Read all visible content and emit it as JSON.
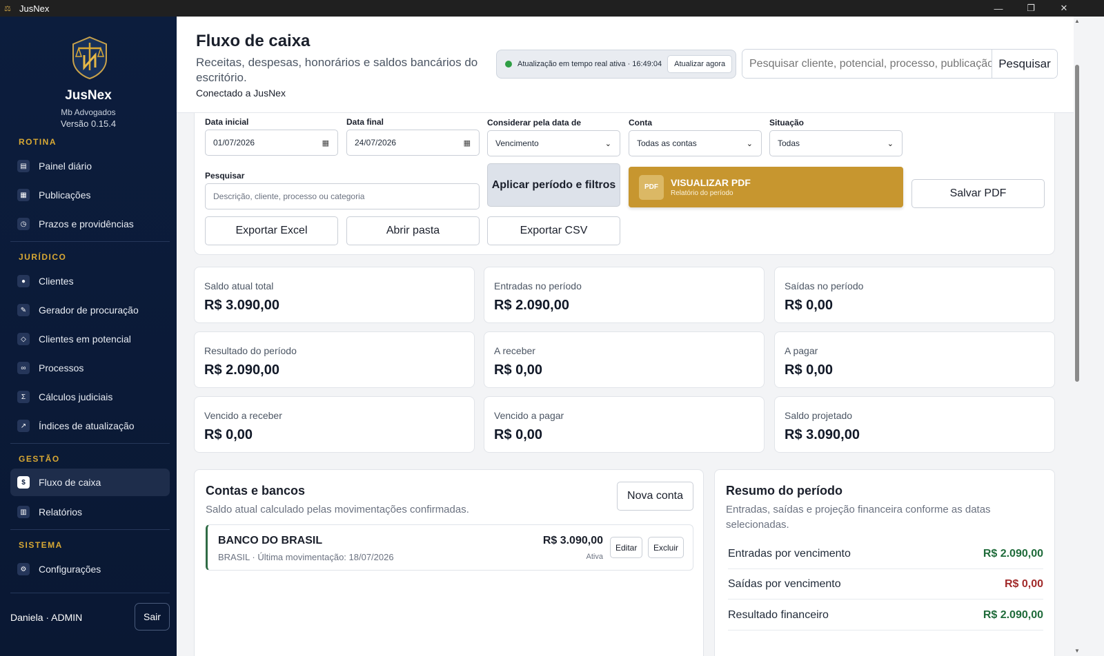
{
  "window": {
    "title": "JusNex",
    "minimize": "—",
    "maximize": "❐",
    "close": "✕"
  },
  "sidebar": {
    "brand": "JusNex",
    "org": "Mb Advogados",
    "version": "Versão 0.15.4",
    "sections": {
      "rotina": "ROTINA",
      "juridico": "JURÍDICO",
      "gestao": "GESTÃO",
      "sistema": "SISTEMA"
    },
    "items": {
      "painel": "Painel diário",
      "publicacoes": "Publicações",
      "prazos": "Prazos e providências",
      "clientes": "Clientes",
      "procuracao": "Gerador de procuração",
      "potencial": "Clientes em potencial",
      "processos": "Processos",
      "calculos": "Cálculos judiciais",
      "indices": "Índices de atualização",
      "fluxo": "Fluxo de caixa",
      "relatorios": "Relatórios",
      "config": "Configurações"
    },
    "user": "Daniela · ADMIN",
    "logout": "Sair"
  },
  "header": {
    "title": "Fluxo de caixa",
    "subtitle": "Receitas, despesas, honorários e saldos bancários do escritório.",
    "connected": "Conectado a JusNex",
    "realtime": "Atualização em tempo real ativa · 16:49:04",
    "refresh": "Atualizar agora",
    "search_placeholder": "Pesquisar cliente, potencial, processo, publicação",
    "search_button": "Pesquisar"
  },
  "filters": {
    "start_label": "Data inicial",
    "start_value": "01/07/2026",
    "end_label": "Data final",
    "end_value": "24/07/2026",
    "consider_label": "Considerar pela data de",
    "consider_value": "Vencimento",
    "account_label": "Conta",
    "account_value": "Todas as contas",
    "status_label": "Situação",
    "status_value": "Todas",
    "search_label": "Pesquisar",
    "search_placeholder": "Descrição, cliente, processo ou categoria",
    "apply": "Aplicar período e filtros",
    "pdf_badge": "PDF",
    "pdf_title": "VISUALIZAR PDF",
    "pdf_sub": "Relatório do período",
    "save_pdf": "Salvar PDF",
    "export_excel": "Exportar Excel",
    "open_folder": "Abrir pasta",
    "export_csv": "Exportar CSV"
  },
  "cards": [
    {
      "label": "Saldo atual total",
      "value": "R$ 3.090,00"
    },
    {
      "label": "Entradas no período",
      "value": "R$ 2.090,00"
    },
    {
      "label": "Saídas no período",
      "value": "R$ 0,00"
    },
    {
      "label": "Resultado do período",
      "value": "R$ 2.090,00"
    },
    {
      "label": "A receber",
      "value": "R$ 0,00"
    },
    {
      "label": "A pagar",
      "value": "R$ 0,00"
    },
    {
      "label": "Vencido a receber",
      "value": "R$ 0,00"
    },
    {
      "label": "Vencido a pagar",
      "value": "R$ 0,00"
    },
    {
      "label": "Saldo projetado",
      "value": "R$ 3.090,00"
    }
  ],
  "accounts": {
    "title": "Contas e bancos",
    "subtitle": "Saldo atual calculado pelas movimentações confirmadas.",
    "new_button": "Nova conta",
    "bank": {
      "name": "BANCO DO BRASIL",
      "info": "BRASIL · Última movimentação: 18/07/2026",
      "value": "R$ 3.090,00",
      "status": "Ativa",
      "edit": "Editar",
      "delete": "Excluir"
    }
  },
  "summary": {
    "title": "Resumo do período",
    "subtitle": "Entradas, saídas e projeção financeira conforme as datas selecionadas.",
    "rows": [
      {
        "label": "Entradas por vencimento",
        "value": "R$ 2.090,00",
        "color": "#1f6b3a"
      },
      {
        "label": "Saídas por vencimento",
        "value": "R$ 0,00",
        "color": "#a12a2a"
      },
      {
        "label": "Resultado financeiro",
        "value": "R$ 2.090,00",
        "color": "#1f6b3a"
      }
    ]
  },
  "colors": {
    "accent_gold": "#c7962f",
    "sidebar_bg": "#0c1d3d",
    "section_gold": "#d9a934"
  }
}
